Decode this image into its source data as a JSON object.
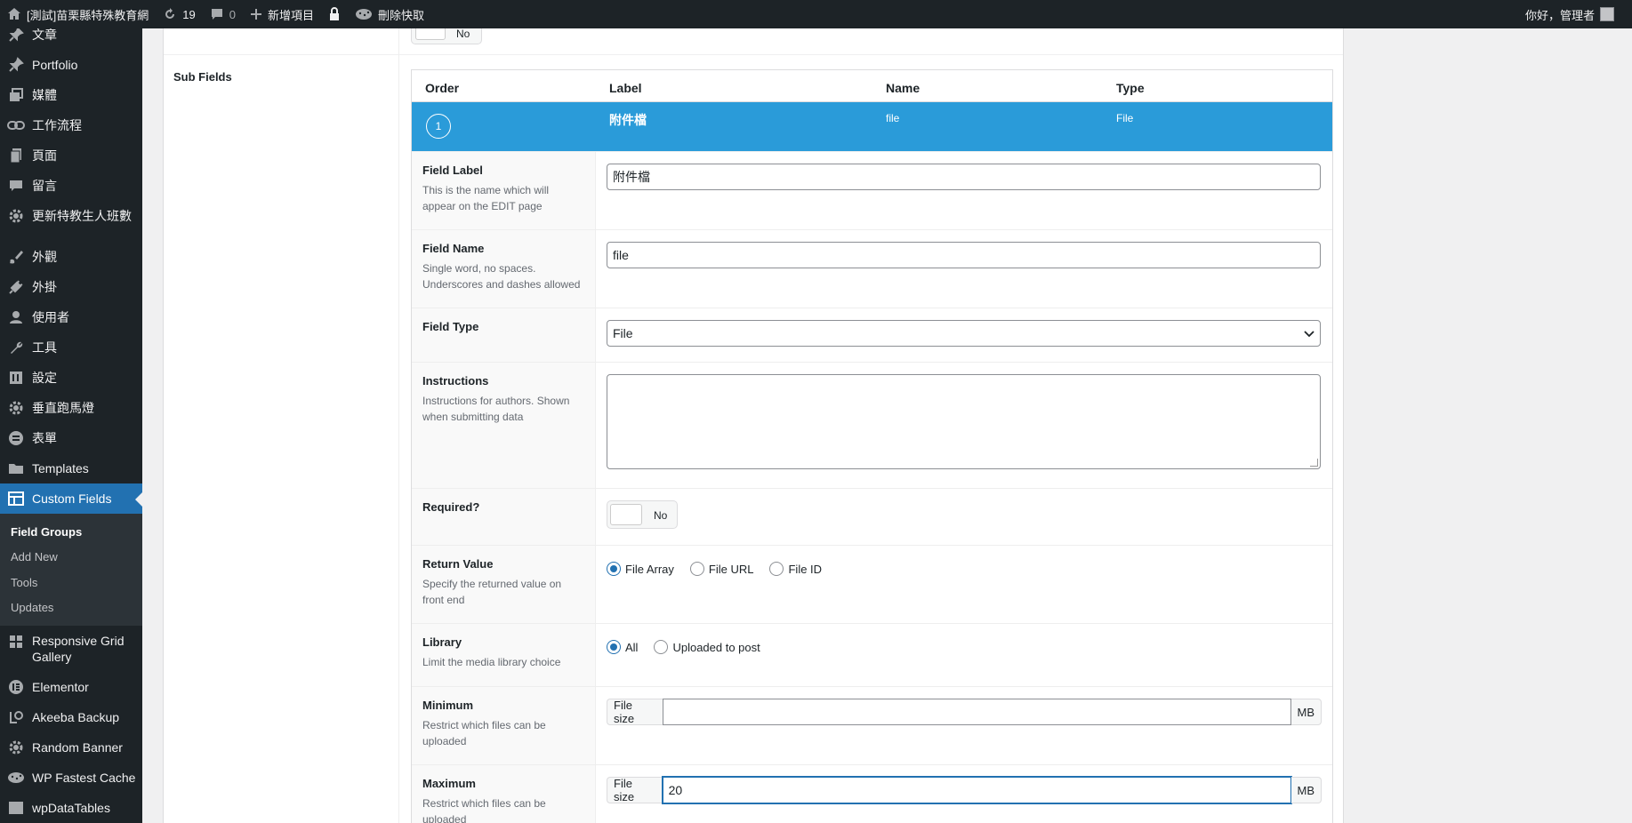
{
  "adminbar": {
    "site_name": "[測試]苗栗縣特殊教育網",
    "updates_count": "19",
    "comments_count": "0",
    "new_label": "新增項目",
    "cache_label": "刪除快取",
    "greeting": "你好，管理者"
  },
  "sidebar": {
    "items": [
      {
        "label": "文章",
        "icon": "pin-icon"
      },
      {
        "label": "Portfolio",
        "icon": "pin-icon"
      },
      {
        "label": "媒體",
        "icon": "media-icon"
      },
      {
        "label": "工作流程",
        "icon": "link-icon"
      },
      {
        "label": "頁面",
        "icon": "page-icon"
      },
      {
        "label": "留言",
        "icon": "comment-icon"
      },
      {
        "label": "更新特教生人班數",
        "icon": "gear-icon"
      },
      {
        "label": "外觀",
        "icon": "brush-icon"
      },
      {
        "label": "外掛",
        "icon": "plug-icon"
      },
      {
        "label": "使用者",
        "icon": "user-icon"
      },
      {
        "label": "工具",
        "icon": "wrench-icon"
      },
      {
        "label": "設定",
        "icon": "settings-icon"
      },
      {
        "label": "垂直跑馬燈",
        "icon": "gear-icon"
      },
      {
        "label": "表單",
        "icon": "form-icon"
      },
      {
        "label": "Templates",
        "icon": "folder-icon"
      },
      {
        "label": "Custom Fields",
        "icon": "table-icon"
      }
    ],
    "submenu": [
      "Field Groups",
      "Add New",
      "Tools",
      "Updates"
    ],
    "items_after": [
      {
        "label": "Responsive Grid Gallery",
        "icon": "grid-icon"
      },
      {
        "label": "Elementor",
        "icon": "elementor-icon"
      },
      {
        "label": "Akeeba Backup",
        "icon": "backup-icon"
      },
      {
        "label": "Random Banner",
        "icon": "gear-icon"
      },
      {
        "label": "WP Fastest Cache",
        "icon": "cheetah-icon"
      },
      {
        "label": "wpDataTables",
        "icon": "table-icon"
      }
    ]
  },
  "main": {
    "top_toggle_label": "No",
    "subfields_label": "Sub Fields",
    "table": {
      "headers": [
        "Order",
        "Label",
        "Name",
        "Type"
      ],
      "row": {
        "order": "1",
        "label": "附件檔",
        "name": "file",
        "type": "File"
      }
    },
    "fields": {
      "field_label": {
        "title": "Field Label",
        "desc": "This is the name which will appear on the EDIT page",
        "value": "附件檔"
      },
      "field_name": {
        "title": "Field Name",
        "desc": "Single word, no spaces. Underscores and dashes allowed",
        "value": "file"
      },
      "field_type": {
        "title": "Field Type",
        "value": "File"
      },
      "instructions": {
        "title": "Instructions",
        "desc": "Instructions for authors. Shown when submitting data",
        "value": ""
      },
      "required": {
        "title": "Required?",
        "value": "No"
      },
      "return_value": {
        "title": "Return Value",
        "desc": "Specify the returned value on front end",
        "options": [
          "File Array",
          "File URL",
          "File ID"
        ],
        "selected": "File Array"
      },
      "library": {
        "title": "Library",
        "desc": "Limit the media library choice",
        "options": [
          "All",
          "Uploaded to post"
        ],
        "selected": "All"
      },
      "minimum": {
        "title": "Minimum",
        "desc": "Restrict which files can be uploaded",
        "prepend": "File size",
        "value": "",
        "append": "MB"
      },
      "maximum": {
        "title": "Maximum",
        "desc": "Restrict which files can be uploaded",
        "prepend": "File size",
        "value": "20",
        "append": "MB"
      }
    }
  },
  "colors": {
    "accent": "#2271b1",
    "row_highlight": "#2a9bd9",
    "adminbar_bg": "#1d2327"
  }
}
